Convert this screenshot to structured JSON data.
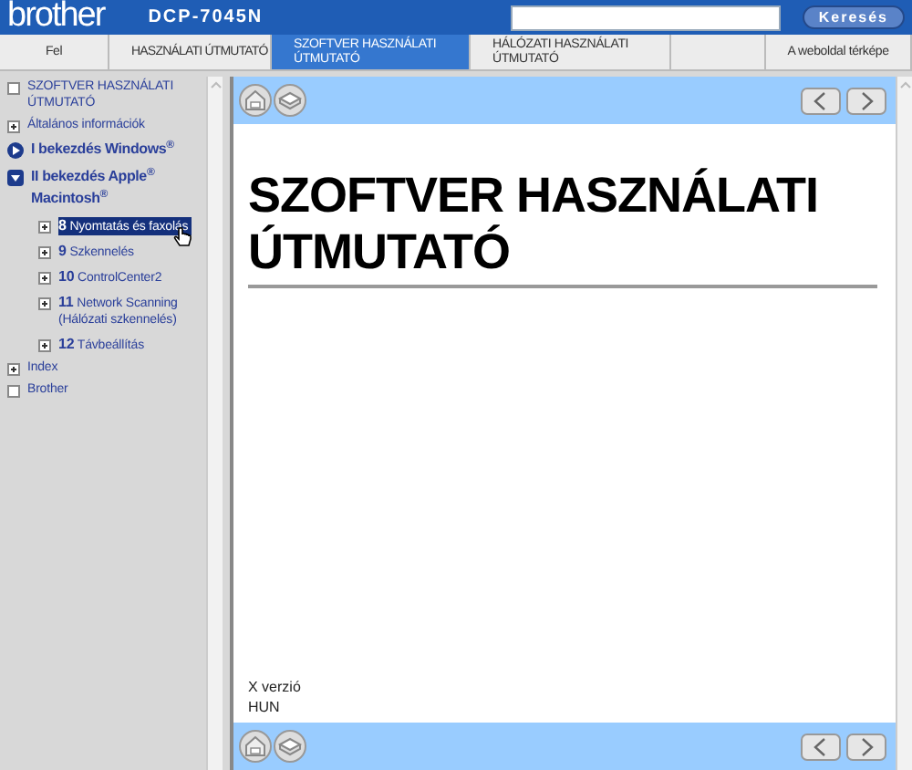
{
  "header": {
    "logo": "brother",
    "model": "DCP-7045N",
    "search_button": "Keresés"
  },
  "tabs": [
    {
      "label": "Fel",
      "selected": false
    },
    {
      "label": "HASZNÁLATI ÚTMUTATÓ",
      "selected": false
    },
    {
      "label": "SZOFTVER HASZNÁLATI ÚTMUTATÓ",
      "selected": true
    },
    {
      "label": "HÁLÓZATI HASZNÁLATI ÚTMUTATÓ",
      "selected": false
    },
    {
      "label": "A weboldal térképe",
      "selected": false
    }
  ],
  "sidebar": {
    "items": [
      {
        "kind": "page",
        "label": "SZOFTVER HASZNÁLATI ÚTMUTATÓ",
        "selected": false
      },
      {
        "kind": "folder",
        "label": "Általános információk",
        "expanded": false,
        "selected": false
      },
      {
        "kind": "part",
        "label": "I bekezdés Windows$^{®}$",
        "expanded": false,
        "selected": false
      },
      {
        "kind": "part",
        "label": "II bekezdés Apple$^{®}$ Macintosh$^{®}$",
        "expanded": true,
        "selected": false,
        "children": [
          {
            "kind": "folder",
            "number": "8",
            "label": "Nyomtatás és faxolás",
            "expanded": false,
            "selected": true
          },
          {
            "kind": "folder",
            "number": "9",
            "label": "Szkennelés",
            "expanded": false,
            "selected": false
          },
          {
            "kind": "folder",
            "number": "10",
            "label": "ControlCenter2",
            "expanded": false,
            "selected": false
          },
          {
            "kind": "folder",
            "number": "11",
            "label": "Network Scanning (Hálózati szkennelés)",
            "expanded": false,
            "selected": false
          },
          {
            "kind": "folder",
            "number": "12",
            "label": "Távbeállítás",
            "expanded": false,
            "selected": false
          }
        ]
      },
      {
        "kind": "folder",
        "label": "Index",
        "expanded": false,
        "selected": false
      },
      {
        "kind": "page",
        "label": "Brother",
        "selected": false
      }
    ]
  },
  "content": {
    "title": "SZOFTVER HASZNÁLATI ÚTMUTATÓ",
    "version": "X verzió",
    "language": "HUN"
  }
}
